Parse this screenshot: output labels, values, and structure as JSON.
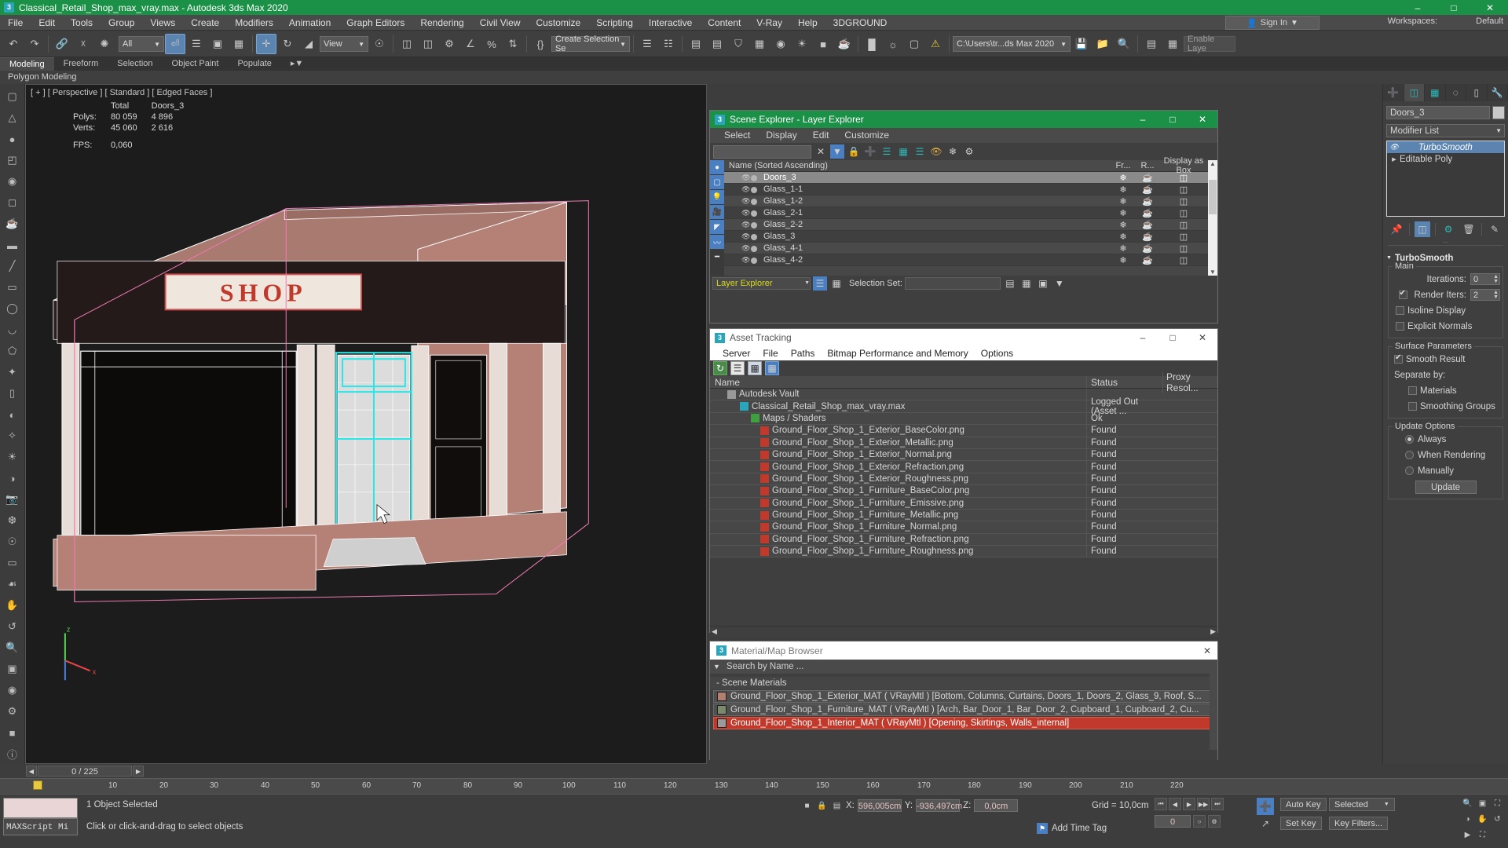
{
  "titlebar": {
    "title": "Classical_Retail_Shop_max_vray.max - Autodesk 3ds Max 2020",
    "app_icon": "3",
    "minimize": "–",
    "maximize": "□",
    "close": "✕"
  },
  "menubar": {
    "items": [
      "File",
      "Edit",
      "Tools",
      "Group",
      "Views",
      "Create",
      "Modifiers",
      "Animation",
      "Graph Editors",
      "Rendering",
      "Civil View",
      "Customize",
      "Scripting",
      "Interactive",
      "Content",
      "V-Ray",
      "Help",
      "3DGROUND"
    ],
    "sign_in": "Sign In",
    "workspaces_label": "Workspaces:",
    "workspace_value": "Default"
  },
  "toolbar": {
    "selection_filter": "All",
    "view_mode": "View",
    "named_set": "Create Selection Se",
    "project_path": "C:\\Users\\tr...ds Max 2020",
    "enable_layer": "Enable Laye"
  },
  "ribbon": {
    "tabs": [
      "Modeling",
      "Freeform",
      "Selection",
      "Object Paint",
      "Populate"
    ],
    "active_tab": "Modeling",
    "subtitle": "Polygon Modeling"
  },
  "viewport": {
    "label": "[ + ] [ Perspective ] [ Standard ] [ Edged Faces ]",
    "stats": {
      "col_headers": [
        "",
        "Total",
        "Doors_3"
      ],
      "rows": [
        {
          "label": "Polys:",
          "total": "80 059",
          "object": "4 896"
        },
        {
          "label": "Verts:",
          "total": "45 060",
          "object": "2 616"
        }
      ],
      "fps_label": "FPS:",
      "fps_value": "0,060"
    },
    "sign_text": "SHOP"
  },
  "scene_explorer": {
    "title": "Scene Explorer - Layer Explorer",
    "menu": [
      "Select",
      "Display",
      "Edit",
      "Customize"
    ],
    "search_value": "",
    "columns": [
      "Name (Sorted Ascending)",
      "Fr...",
      "R...",
      "Display as Box"
    ],
    "rows": [
      {
        "name": "Doors_3",
        "selected": true
      },
      {
        "name": "Glass_1-1",
        "selected": false
      },
      {
        "name": "Glass_1-2",
        "selected": false
      },
      {
        "name": "Glass_2-1",
        "selected": false
      },
      {
        "name": "Glass_2-2",
        "selected": false
      },
      {
        "name": "Glass_3",
        "selected": false
      },
      {
        "name": "Glass_4-1",
        "selected": false
      },
      {
        "name": "Glass_4-2",
        "selected": false
      }
    ],
    "footer_dropdown": "Layer Explorer",
    "selection_set_label": "Selection Set:",
    "selection_set_value": ""
  },
  "asset_tracking": {
    "title": "Asset Tracking",
    "menu": [
      "Server",
      "File",
      "Paths",
      "Bitmap Performance and Memory",
      "Options"
    ],
    "columns": [
      "Name",
      "Status",
      "Proxy Resol..."
    ],
    "rows": [
      {
        "name": "Autodesk Vault",
        "indent": 1,
        "icon": "vault-icon",
        "status": "",
        "proxy": ""
      },
      {
        "name": "Classical_Retail_Shop_max_vray.max",
        "indent": 2,
        "icon": "max-file-icon",
        "status": "Logged Out (Asset ...",
        "proxy": ""
      },
      {
        "name": "Maps / Shaders",
        "indent": 3,
        "icon": "maps-icon",
        "status": "Ok",
        "proxy": ""
      },
      {
        "name": "Ground_Floor_Shop_1_Exterior_BaseColor.png",
        "indent": 4,
        "icon": "bitmap-icon",
        "status": "Found",
        "proxy": ""
      },
      {
        "name": "Ground_Floor_Shop_1_Exterior_Metallic.png",
        "indent": 4,
        "icon": "bitmap-icon",
        "status": "Found",
        "proxy": ""
      },
      {
        "name": "Ground_Floor_Shop_1_Exterior_Normal.png",
        "indent": 4,
        "icon": "bitmap-icon",
        "status": "Found",
        "proxy": ""
      },
      {
        "name": "Ground_Floor_Shop_1_Exterior_Refraction.png",
        "indent": 4,
        "icon": "bitmap-icon",
        "status": "Found",
        "proxy": ""
      },
      {
        "name": "Ground_Floor_Shop_1_Exterior_Roughness.png",
        "indent": 4,
        "icon": "bitmap-icon",
        "status": "Found",
        "proxy": ""
      },
      {
        "name": "Ground_Floor_Shop_1_Furniture_BaseColor.png",
        "indent": 4,
        "icon": "bitmap-icon",
        "status": "Found",
        "proxy": ""
      },
      {
        "name": "Ground_Floor_Shop_1_Furniture_Emissive.png",
        "indent": 4,
        "icon": "bitmap-icon",
        "status": "Found",
        "proxy": ""
      },
      {
        "name": "Ground_Floor_Shop_1_Furniture_Metallic.png",
        "indent": 4,
        "icon": "bitmap-icon",
        "status": "Found",
        "proxy": ""
      },
      {
        "name": "Ground_Floor_Shop_1_Furniture_Normal.png",
        "indent": 4,
        "icon": "bitmap-icon",
        "status": "Found",
        "proxy": ""
      },
      {
        "name": "Ground_Floor_Shop_1_Furniture_Refraction.png",
        "indent": 4,
        "icon": "bitmap-icon",
        "status": "Found",
        "proxy": ""
      },
      {
        "name": "Ground_Floor_Shop_1_Furniture_Roughness.png",
        "indent": 4,
        "icon": "bitmap-icon",
        "status": "Found",
        "proxy": ""
      }
    ]
  },
  "material_browser": {
    "title": "Material/Map Browser",
    "search_placeholder": "Search by Name ...",
    "group_label": "- Scene Materials",
    "materials": [
      {
        "name": "Ground_Floor_Shop_1_Exterior_MAT ( VRayMtl ) [Bottom, Columns, Curtains, Doors_1, Doors_2, Glass_9, Roof, S...",
        "highlight": false,
        "swatch": "#b08070"
      },
      {
        "name": "Ground_Floor_Shop_1_Furniture_MAT ( VRayMtl ) [Arch, Bar_Door_1, Bar_Door_2, Cupboard_1, Cupboard_2, Cu...",
        "highlight": false,
        "swatch": "#7a8a6a"
      },
      {
        "name": "Ground_Floor_Shop_1_Interior_MAT ( VRayMtl ) [Opening, Skirtings, Walls_internal]",
        "highlight": true,
        "swatch": "#9a9a9a"
      }
    ]
  },
  "command_panel": {
    "tabs": [
      "create-tab",
      "modify-tab",
      "hierarchy-tab",
      "motion-tab",
      "display-tab",
      "utilities-tab"
    ],
    "active_tab_index": 1,
    "object_name": "Doors_3",
    "modifier_list_label": "Modifier List",
    "stack": [
      {
        "name": "TurboSmooth",
        "selected": true
      },
      {
        "name": "Editable Poly",
        "selected": false
      }
    ],
    "rollout": {
      "title": "TurboSmooth",
      "main_label": "Main",
      "iterations_label": "Iterations:",
      "iterations_value": "0",
      "render_iters_label": "Render Iters:",
      "render_iters_value": "2",
      "render_iters_checked": true,
      "isoline_display_label": "Isoline Display",
      "isoline_display_checked": false,
      "explicit_normals_label": "Explicit Normals",
      "explicit_normals_checked": false,
      "surface_params_label": "Surface Parameters",
      "smooth_result_label": "Smooth Result",
      "smooth_result_checked": true,
      "separate_by_label": "Separate by:",
      "materials_label": "Materials",
      "materials_checked": false,
      "smoothing_groups_label": "Smoothing Groups",
      "smoothing_groups_checked": false,
      "update_options_label": "Update Options",
      "update_always_label": "Always",
      "update_when_rendering_label": "When Rendering",
      "update_manually_label": "Manually",
      "update_selected": "Always",
      "update_button": "Update"
    }
  },
  "trackbar": {
    "frame_display": "0 / 225",
    "prev": "◀",
    "next": "▶"
  },
  "ruler": {
    "ticks": [
      "10",
      "20",
      "30",
      "40",
      "50",
      "60",
      "70",
      "80",
      "90",
      "100",
      "110",
      "120",
      "130",
      "140",
      "150",
      "160",
      "170",
      "180",
      "190",
      "200",
      "210",
      "220"
    ]
  },
  "statusbar": {
    "maxscript_label": "MAXScript Mi",
    "selection_status": "1 Object Selected",
    "prompt": "Click or click-and-drag to select objects",
    "coords": {
      "x_label": "X:",
      "x_value": "596,005cm",
      "y_label": "Y:",
      "y_value": "-936,497cm",
      "z_label": "Z:",
      "z_value": "0,0cm"
    },
    "grid": "Grid = 10,0cm",
    "add_time_tag": "Add Time Tag",
    "auto_key": "Auto Key",
    "set_key": "Set Key",
    "selected_dropdown": "Selected",
    "key_filters": "Key Filters...",
    "key_frame_value": "0"
  },
  "colors": {
    "title_green": "#1a9147",
    "accent_blue": "#5b84b1",
    "panel_bg": "#3f3f3f",
    "viewport_bg": "#1c1c1c",
    "wall_pink": "#b58176",
    "selection_cyan": "#30e8e8",
    "highlight_red": "#c0392b"
  }
}
